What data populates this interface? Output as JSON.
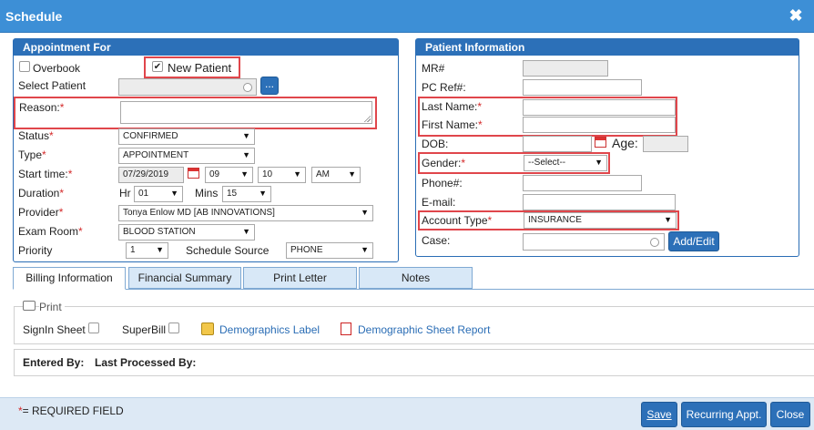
{
  "window": {
    "title": "Schedule"
  },
  "appointment": {
    "header": "Appointment For",
    "overbook_label": "Overbook",
    "new_patient_label": "New Patient",
    "select_patient_label": "Select Patient",
    "select_patient_button": "...",
    "reason_label": "Reason:",
    "status_label": "Status",
    "status_value": "CONFIRMED",
    "type_label": "Type",
    "type_value": "APPOINTMENT",
    "start_time_label": "Start time:",
    "date_value": "07/29/2019",
    "hour_value": "09",
    "minute_value": "10",
    "ampm_value": "AM",
    "duration_label": "Duration",
    "hr_label": "Hr",
    "hr_value": "01",
    "mins_label": "Mins",
    "mins_value": "15",
    "provider_label": "Provider",
    "provider_value": "Tonya Enlow MD [AB INNOVATIONS]",
    "exam_room_label": "Exam Room",
    "exam_room_value": "BLOOD STATION",
    "priority_label": "Priority",
    "priority_value": "1",
    "schedule_source_label": "Schedule Source",
    "schedule_source_value": "PHONE"
  },
  "patient": {
    "header": "Patient Information",
    "mr_label": "MR#",
    "pcref_label": "PC Ref#:",
    "last_name_label": "Last Name:",
    "first_name_label": "First Name:",
    "dob_label": "DOB:",
    "age_label": "Age:",
    "gender_label": "Gender:",
    "gender_value": "--Select--",
    "phone_label": "Phone#:",
    "email_label": "E-mail:",
    "account_type_label": "Account Type",
    "account_type_value": "INSURANCE",
    "case_label": "Case:",
    "add_edit_button": "Add/Edit"
  },
  "tabs": [
    "Billing Information",
    "Financial Summary",
    "Print Letter",
    "Notes"
  ],
  "billing": {
    "print_legend": "Print",
    "signin_label": "SignIn Sheet",
    "superbill_label": "SuperBill",
    "demographics_label": "Demographics Label",
    "demographic_sheet_label": "Demographic Sheet Report",
    "entered_by_label": "Entered By:",
    "last_processed_label": "Last Processed By:"
  },
  "footer": {
    "required_mark": "*",
    "required_text": "= REQUIRED FIELD",
    "save_button": "Save",
    "recurring_button": "Recurring Appt.",
    "close_button": "Close"
  },
  "colors": {
    "title_bar": "#3d8fd6",
    "panel_header": "#2c70b8",
    "highlight": "#e0464b",
    "footer_bg": "#dde9f5"
  },
  "icons": {
    "close": "close-icon",
    "calendar": "calendar-icon",
    "print": "printer-icon",
    "label": "label-icon",
    "pdf": "pdf-icon"
  }
}
